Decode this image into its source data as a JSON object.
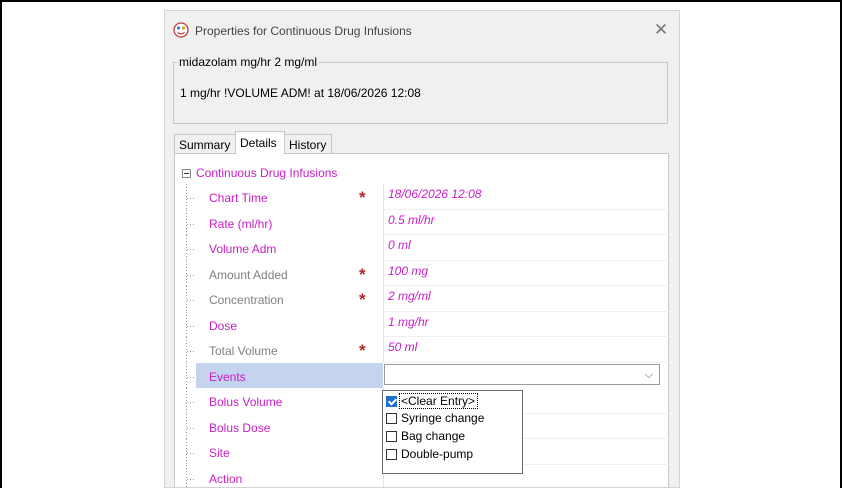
{
  "dialog": {
    "title": "Properties for Continuous Drug Infusions",
    "close_glyph": "✕"
  },
  "summary_box": {
    "legend": "midazolam mg/hr 2 mg/ml",
    "text": "1 mg/hr !VOLUME ADM! at 18/06/2026 12:08"
  },
  "tabs": [
    {
      "label": "Summary",
      "active": false
    },
    {
      "label": "Details",
      "active": true
    },
    {
      "label": "History",
      "active": false
    }
  ],
  "category": {
    "label": "Continuous Drug Infusions",
    "icon": "collapse-minus-icon"
  },
  "required_marker": "*",
  "properties": [
    {
      "name": "Chart Time",
      "value": "18/06/2026 12:08",
      "required": true,
      "grey": false
    },
    {
      "name": "Rate (ml/hr)",
      "value": "0.5 ml/hr",
      "required": false,
      "grey": false
    },
    {
      "name": "Volume Adm",
      "value": "0 ml",
      "required": false,
      "grey": false
    },
    {
      "name": "Amount Added",
      "value": "100 mg",
      "required": true,
      "grey": true
    },
    {
      "name": "Concentration",
      "value": "2 mg/ml",
      "required": true,
      "grey": true
    },
    {
      "name": "Dose",
      "value": "1 mg/hr",
      "required": false,
      "grey": false
    },
    {
      "name": "Total Volume",
      "value": "50 ml",
      "required": true,
      "grey": true
    },
    {
      "name": "Events",
      "value": "",
      "required": false,
      "grey": false
    },
    {
      "name": "Bolus Volume",
      "value": "",
      "required": false,
      "grey": false
    },
    {
      "name": "Bolus Dose",
      "value": "",
      "required": false,
      "grey": false
    },
    {
      "name": "Site",
      "value": "",
      "required": false,
      "grey": false
    },
    {
      "name": "Action",
      "value": "",
      "required": false,
      "grey": false
    }
  ],
  "events_dropdown": {
    "chevron": "⌵",
    "options": [
      {
        "label": "<Clear Entry>",
        "checked": true
      },
      {
        "label": "Syringe change",
        "checked": false
      },
      {
        "label": "Bag change",
        "checked": false
      },
      {
        "label": "Double-pump",
        "checked": false
      }
    ]
  },
  "colors": {
    "property_text": "#c71ec7",
    "grey_text": "#808080",
    "required_marker": "#b0282d",
    "selection": "#c4d3ee"
  }
}
